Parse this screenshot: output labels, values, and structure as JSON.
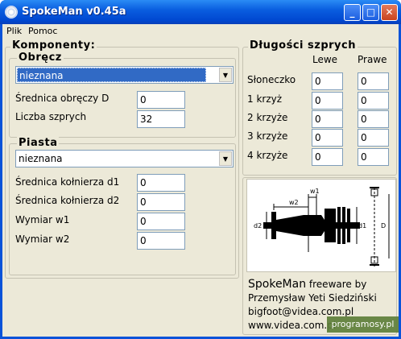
{
  "window": {
    "title": "SpokeMan v0.45a",
    "minimize": "_",
    "maximize": "□",
    "close": "✕"
  },
  "menu": [
    {
      "label": "Plik"
    },
    {
      "label": "Pomoc"
    }
  ],
  "komponenty": {
    "title": "Komponenty:",
    "obrecz": {
      "title": "Obręcz",
      "combo_value": "nieznana",
      "srednica_label": "Średnica obręczy D",
      "srednica_value": "0",
      "liczba_label": "Liczba szprych",
      "liczba_value": "32"
    },
    "piasta": {
      "title": "Piasta",
      "combo_value": "nieznana",
      "d1_label": "Średnica kołnierza d1",
      "d1_value": "0",
      "d2_label": "Średnica kołnierza d2",
      "d2_value": "0",
      "w1_label": "Wymiar w1",
      "w1_value": "0",
      "w2_label": "Wymiar w2",
      "w2_value": "0"
    }
  },
  "dlugosci": {
    "title": "Długości szprych",
    "col_lewe": "Lewe",
    "col_prawe": "Prawe",
    "rows": [
      {
        "label": "Słoneczko",
        "lewe": "0",
        "prawe": "0"
      },
      {
        "label": "1 krzyż",
        "lewe": "0",
        "prawe": "0"
      },
      {
        "label": "2 krzyże",
        "lewe": "0",
        "prawe": "0"
      },
      {
        "label": "3 krzyże",
        "lewe": "0",
        "prawe": "0"
      },
      {
        "label": "4 krzyże",
        "lewe": "0",
        "prawe": "0"
      }
    ]
  },
  "diagram": {
    "w1": "w1",
    "w2": "w2",
    "d1": "d1",
    "d2": "d2",
    "D": "D"
  },
  "credits": {
    "app_name": "SpokeMan",
    "freeware_by": " freeware by",
    "author": "Przemysław Yeti Siedziński",
    "email": "bigfoot@videa.com.pl",
    "website": "www.videa.com.pl"
  },
  "watermark": "programosy.pl",
  "colors": {
    "titlebar": "#0a5ee0",
    "face": "#ece9d8",
    "selection": "#316ac5",
    "field_border": "#7f9db9"
  }
}
